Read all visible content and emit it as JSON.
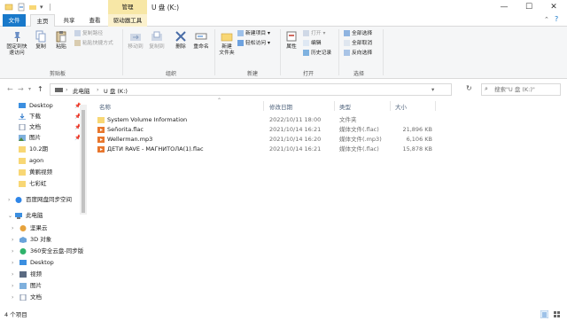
{
  "window": {
    "title": "U 盘 (K:)",
    "context_group": "管理",
    "controls": {
      "minimize": "—",
      "maximize": "☐",
      "close": "✕"
    }
  },
  "tabs": [
    {
      "label": "文件"
    },
    {
      "label": "主页"
    },
    {
      "label": "共享"
    },
    {
      "label": "查看"
    },
    {
      "label": "驱动器工具"
    }
  ],
  "ribbon": {
    "clipboard": {
      "group_label": "剪贴板",
      "pin": "固定到快\n速访问",
      "copy": "复制",
      "paste": "粘贴",
      "copy_path": "复制路径",
      "paste_shortcut": "粘贴快捷方式"
    },
    "organize": {
      "group_label": "组织",
      "move_to": "移动到",
      "copy_to": "复制到",
      "delete": "删除",
      "rename": "重命名"
    },
    "new": {
      "group_label": "新建",
      "new_folder": "新建\n文件夹",
      "new_item": "新建项目",
      "easy_access": "轻松访问"
    },
    "open": {
      "group_label": "打开",
      "properties": "属性",
      "open": "打开",
      "edit": "编辑",
      "history": "历史记录"
    },
    "select": {
      "group_label": "选择",
      "select_all": "全部选择",
      "select_none": "全部取消",
      "invert": "反向选择"
    }
  },
  "address": {
    "segments": [
      "此电脑",
      "U 盘 (K:)"
    ],
    "search_placeholder": "搜索\"U 盘 (K:)\""
  },
  "nav": {
    "quick_access": [
      {
        "label": "Desktop",
        "pinned": true
      },
      {
        "label": "下载",
        "pinned": true
      },
      {
        "label": "文档",
        "pinned": true
      },
      {
        "label": "图片",
        "pinned": true
      },
      {
        "label": "10.2期",
        "pinned": false
      },
      {
        "label": "agon",
        "pinned": false
      },
      {
        "label": "黄鹂视频",
        "pinned": false
      },
      {
        "label": "七彩虹",
        "pinned": false
      }
    ],
    "baidu": "百度网盘同步空间",
    "this_pc": "此电脑",
    "pc_items": [
      {
        "label": "坚果云",
        "icon": "nutstore-icon"
      },
      {
        "label": "3D 对象",
        "icon": "3d-objects-icon"
      },
      {
        "label": "360安全云盘-同步版",
        "icon": "cloud-drive-icon"
      },
      {
        "label": "Desktop",
        "icon": "desktop-icon"
      },
      {
        "label": "视频",
        "icon": "videos-icon"
      },
      {
        "label": "图片",
        "icon": "pictures-icon"
      },
      {
        "label": "文档",
        "icon": "documents-icon"
      }
    ],
    "pin_glyph": "📌"
  },
  "files": {
    "columns": {
      "name": "名称",
      "date": "修改日期",
      "type": "类型",
      "size": "大小"
    },
    "rows": [
      {
        "name": "System Volume Information",
        "date": "2022/10/11 18:00",
        "type": "文件夹",
        "size": "",
        "icon": "folder-icon"
      },
      {
        "name": "Señorita.flac",
        "date": "2021/10/14 16:21",
        "type": "媒体文件(.flac)",
        "size": "21,896 KB",
        "icon": "media-file-icon"
      },
      {
        "name": "Wellerman.mp3",
        "date": "2021/10/14 16:20",
        "type": "媒体文件(.mp3)",
        "size": "6,106 KB",
        "icon": "media-file-icon"
      },
      {
        "name": "ДЕТИ RAVE - МАГНИТОЛА(1).flac",
        "date": "2021/10/14 16:21",
        "type": "媒体文件(.flac)",
        "size": "15,878 KB",
        "icon": "media-file-icon"
      }
    ]
  },
  "status": {
    "count": "4 个项目"
  },
  "colors": {
    "accent": "#1979ca",
    "folder": "#f8d775",
    "media": "#e8772e",
    "context_tab": "#f7e7a6"
  }
}
